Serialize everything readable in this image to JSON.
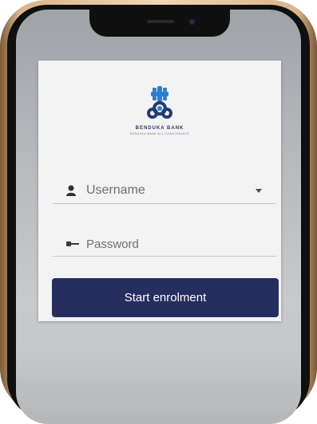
{
  "brand": {
    "name": "BENDUKA BANK",
    "tagline": "BENDUKA BANK ALL CONSTRAINTS"
  },
  "login": {
    "username_placeholder": "Username",
    "password_placeholder": "Password",
    "submit_label": "Start enrolment"
  },
  "icons": {
    "logo": "benduka-bank-logo",
    "username": "user-icon",
    "password": "key-icon",
    "dropdown": "caret-down-icon"
  },
  "colors": {
    "button": "#262d5f",
    "logo_blue": "#2f7fd1",
    "logo_navy": "#243c73",
    "card": "#f3f3f3",
    "frame": "#d8b58a"
  }
}
